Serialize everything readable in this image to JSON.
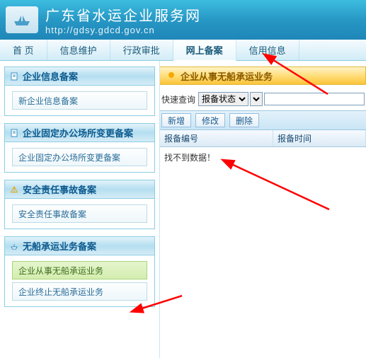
{
  "header": {
    "title": "广东省水运企业服务网",
    "url": "http://gdsy.gdcd.gov.cn"
  },
  "nav": {
    "items": [
      {
        "label": "首 页",
        "active": false
      },
      {
        "label": "信息维护",
        "active": false
      },
      {
        "label": "行政审批",
        "active": false
      },
      {
        "label": "网上备案",
        "active": true
      },
      {
        "label": "信用信息",
        "active": false
      }
    ]
  },
  "sidebar": {
    "panels": [
      {
        "icon": "doc-icon",
        "title": "企业信息备案",
        "items": [
          {
            "label": "新企业信息备案",
            "selected": false
          }
        ]
      },
      {
        "icon": "doc-icon",
        "title": "企业固定办公场所变更备案",
        "items": [
          {
            "label": "企业固定办公场所变更备案",
            "selected": false
          }
        ]
      },
      {
        "icon": "warn-icon",
        "title": "安全责任事故备案",
        "items": [
          {
            "label": "安全责任事故备案",
            "selected": false
          }
        ]
      },
      {
        "icon": "ship-icon",
        "title": "无船承运业务备案",
        "items": [
          {
            "label": "企业从事无船承运业务",
            "selected": true
          },
          {
            "label": "企业终止无船承运业务",
            "selected": false
          }
        ]
      }
    ]
  },
  "main": {
    "title": "企业从事无船承运业务",
    "query": {
      "label": "快速查询",
      "select_value": "报备状态",
      "input_value": ""
    },
    "toolbar": {
      "add": "新增",
      "edit": "修改",
      "delete": "删除"
    },
    "grid": {
      "columns": [
        "报备编号",
        "报备时间"
      ],
      "empty_text": "找不到数据！"
    }
  }
}
